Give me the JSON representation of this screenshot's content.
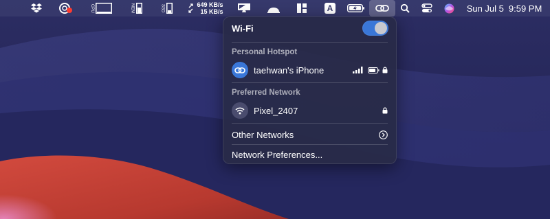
{
  "colors": {
    "accent": "#3a77d8",
    "wallpaper_base": "#27285a",
    "wallpaper_red": "#c8443a",
    "record_dot": "#ff3b30"
  },
  "menubar": {
    "icons": [
      "dropbox-icon",
      "screen-recorder-icon",
      "cpu-monitor-icon",
      "memory-monitor-icon",
      "ssd-monitor-icon",
      "network-speed-icon",
      "display-icon",
      "control-center-extra-icon",
      "window-layout-icon",
      "keyboard-input-icon",
      "battery-icon",
      "link-icon",
      "spotlight-icon",
      "control-center-icon",
      "siri-icon"
    ],
    "cpu_label": "CPU",
    "mem_label": "MEM",
    "ssd_label": "SSD",
    "net_up": "649 KB/s",
    "net_down": "15 KB/s",
    "input_letter": "A",
    "date": "Sun Jul 5",
    "time": "9:59 PM"
  },
  "wifi_panel": {
    "title": "Wi-Fi",
    "toggle_on": true,
    "personal_hotspot_header": "Personal Hotspot",
    "hotspot_name": "taehwan's iPhone",
    "preferred_header": "Preferred Network",
    "preferred_network": "Pixel_2407",
    "other_networks": "Other Networks",
    "network_preferences": "Network Preferences..."
  }
}
